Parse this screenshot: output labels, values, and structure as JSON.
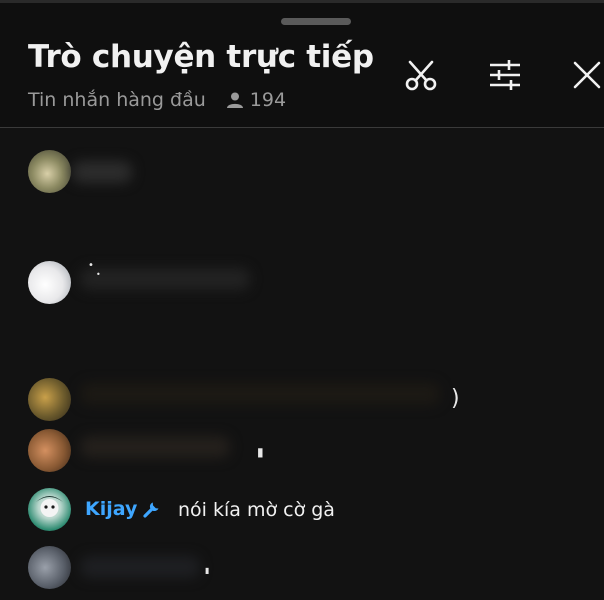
{
  "header": {
    "title": "Trò chuyện trực tiếp",
    "subtitle": "Tin nhắn hàng đầu",
    "viewer_count": "194",
    "icons": [
      "scissors-icon",
      "sliders-icon",
      "close-icon"
    ]
  },
  "messages": [
    {
      "author": "",
      "text": "",
      "blurred": true
    },
    {
      "author": "",
      "text": "",
      "blurred": true
    },
    {
      "author": "",
      "text": "",
      "blurred": true
    },
    {
      "author": "",
      "text": "",
      "blurred": true
    },
    {
      "author": "Kijay",
      "badge": "wrench-icon",
      "text": "nói kía mờ cờ gà",
      "blurred": false
    },
    {
      "author": "",
      "text": "",
      "blurred": true
    }
  ],
  "colors": {
    "background": "#0f0f0f",
    "author_name": "#3ea6ff",
    "text": "#f1f1f1",
    "muted": "#9a9a9a"
  }
}
